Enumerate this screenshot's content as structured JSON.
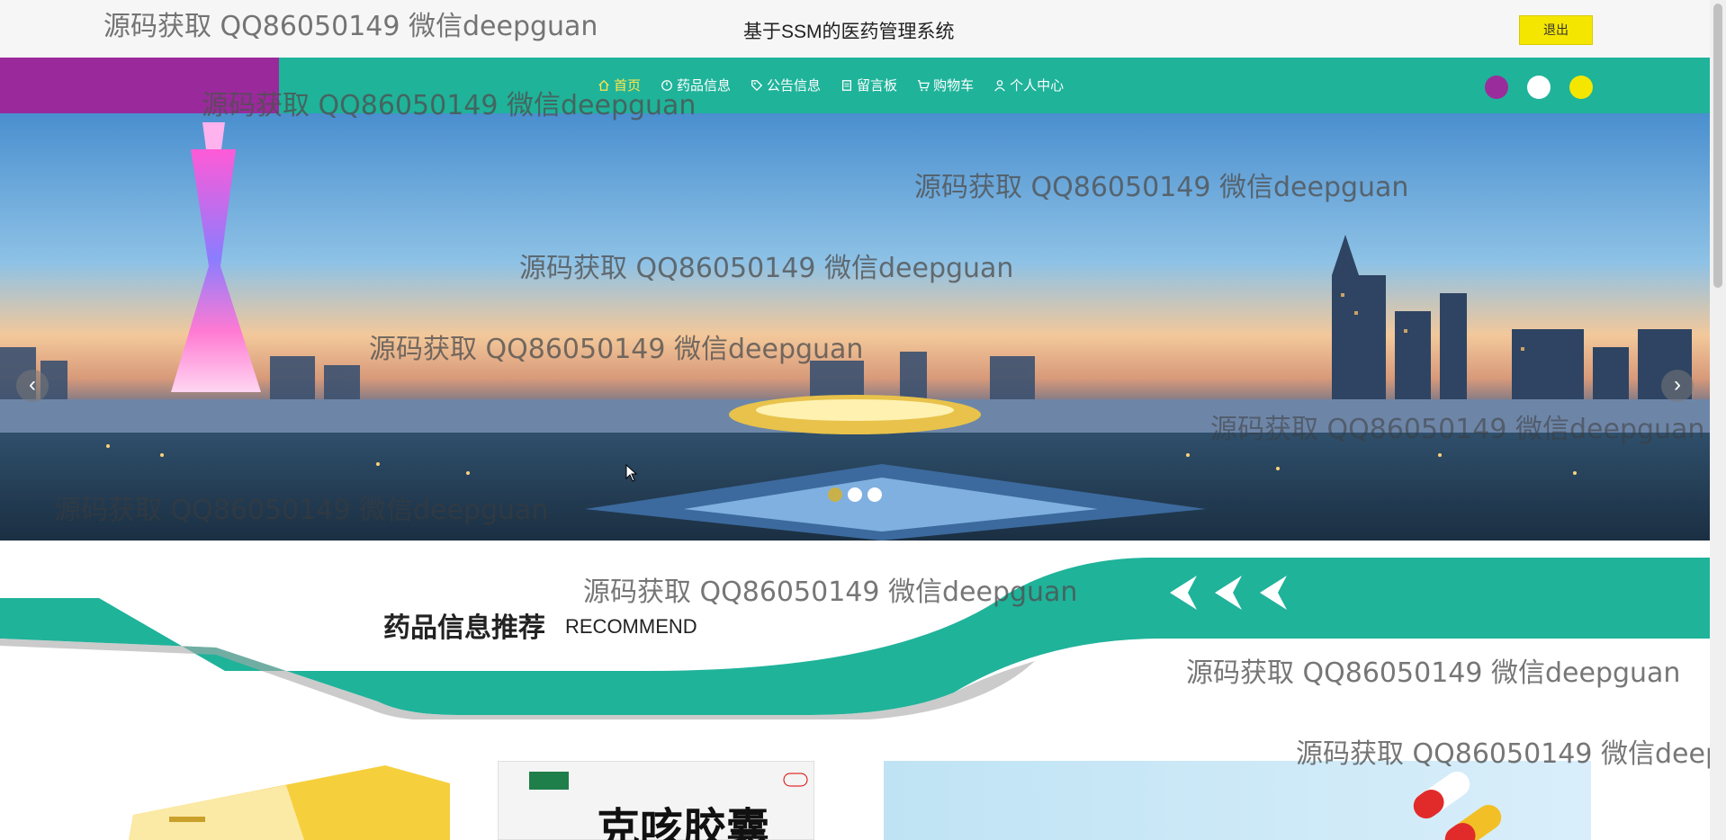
{
  "header": {
    "title": "基于SSM的医药管理系统",
    "logout_label": "退出"
  },
  "nav": {
    "items": [
      {
        "label": "首页",
        "icon": "home-icon",
        "active": true
      },
      {
        "label": "药品信息",
        "icon": "clock-icon"
      },
      {
        "label": "公告信息",
        "icon": "tag-icon"
      },
      {
        "label": "留言板",
        "icon": "document-icon"
      },
      {
        "label": "购物车",
        "icon": "cart-icon"
      },
      {
        "label": "个人中心",
        "icon": "user-icon"
      }
    ],
    "theme_colors": [
      "#9b2c9b",
      "#ffffff",
      "#f5e600"
    ]
  },
  "carousel": {
    "slide_count": 3,
    "active_index": 0,
    "prev_symbol": "‹",
    "next_symbol": "›"
  },
  "recommend": {
    "title": "药品信息推荐",
    "subtitle": "RECOMMEND"
  },
  "products": [
    {
      "name": "product-1",
      "text": ""
    },
    {
      "name": "product-2",
      "text": "克咳胶囊"
    },
    {
      "name": "product-3",
      "text": ""
    }
  ],
  "watermarks": [
    "源码获取 QQ86050149 微信deepguan",
    "源码获取 QQ86050149 微信deepguan",
    "源码获取 QQ86050149 微信deepguan",
    "源码获取 QQ86050149 微信deepguan",
    "源码获取 QQ86050149 微信deepguan",
    "源码获取 QQ86050149 微信deepguan",
    "源码获取 QQ86050149 微信deepguan",
    "源码获取 QQ86050149 微信deepguan",
    "源码获取 QQ86050149 微信deepguan",
    "源码获取 QQ86050149 微信deepguan",
    "源码获取 QQ86050149 微信deepg"
  ]
}
